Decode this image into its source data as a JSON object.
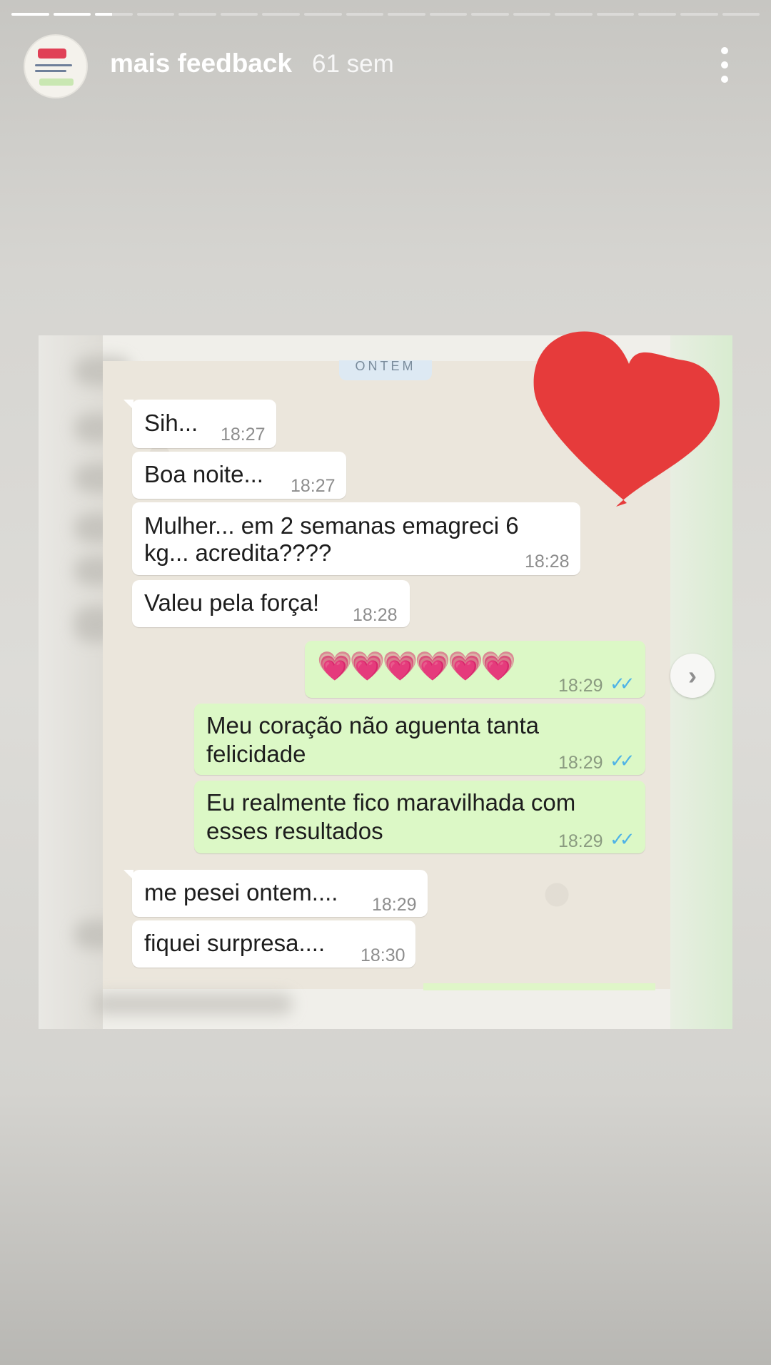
{
  "story": {
    "account_name": "mais feedback",
    "time_ago": "61 sem",
    "segments_total": 18,
    "segments_completed": 2,
    "current_segment_progress": 0.45
  },
  "chat": {
    "date_chip": "ONTEM",
    "messages": [
      {
        "direction": "in",
        "text": "Sih...",
        "time": "18:27"
      },
      {
        "direction": "in",
        "text": "Boa noite...",
        "time": "18:27"
      },
      {
        "direction": "in",
        "text_line1": "Mulher... em 2 semanas emagreci 6",
        "text_line2": "kg... acredita????",
        "time": "18:28"
      },
      {
        "direction": "in",
        "text": "Valeu pela força!",
        "time": "18:28"
      },
      {
        "direction": "out",
        "text": "💗💗💗💗💗💗",
        "time": "18:29",
        "status": "read"
      },
      {
        "direction": "out",
        "text_line1": "Meu coração não aguenta tanta",
        "text_line2": "felicidade",
        "time": "18:29",
        "status": "read"
      },
      {
        "direction": "out",
        "text_line1": "Eu realmente fico maravilhada com",
        "text_line2": "esses resultados",
        "time": "18:29",
        "status": "read"
      },
      {
        "direction": "in",
        "text": "me pesei ontem....",
        "time": "18:29"
      },
      {
        "direction": "in",
        "text": "fiquei surpresa....",
        "time": "18:30"
      }
    ]
  },
  "icons": {
    "heart": "red-heart-icon",
    "more": "more-vertical-icon",
    "forward": "chevron-right-icon",
    "ticks": "double-check-icon"
  },
  "colors": {
    "heart": "#e63b3b",
    "incoming_bubble": "#ffffff",
    "outgoing_bubble": "#dcf8c6",
    "read_ticks": "#4fb3e6"
  }
}
